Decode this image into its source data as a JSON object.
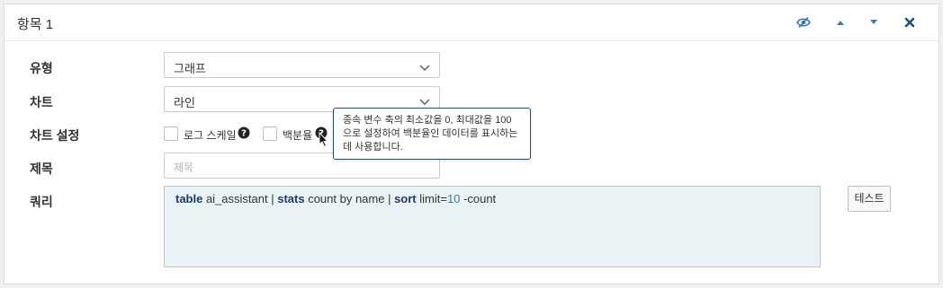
{
  "header": {
    "title": "항목 1",
    "icons": [
      "eye-slash-icon",
      "arrow-up-icon",
      "arrow-down-icon",
      "close-icon"
    ]
  },
  "form": {
    "type": {
      "label": "유형",
      "value": "그래프"
    },
    "chart": {
      "label": "차트",
      "value": "라인"
    },
    "chart_settings": {
      "label": "차트 설정",
      "log_scale_label": "로그 스케일",
      "percentage_label": "백분율"
    },
    "title": {
      "label": "제목",
      "placeholder": "제목"
    },
    "query": {
      "label": "쿼리",
      "tokens": {
        "t1": "table",
        "t2": " ai_assistant | ",
        "t3": "stats",
        "t4": " count by name | ",
        "t5": "sort",
        "t6": " limit=",
        "t7": "10",
        "t8": " -count"
      }
    },
    "test_button": "테스트"
  },
  "tooltip": {
    "text": "종속 변수 축의 최소값을 0, 최대값을 100 으로 설정하여 백분율인 데이터를 표시하는 데 사용합니다."
  },
  "colors": {
    "accent": "#3a78a8",
    "close": "#1f4f7f",
    "query_bg": "#e9f2f4"
  }
}
